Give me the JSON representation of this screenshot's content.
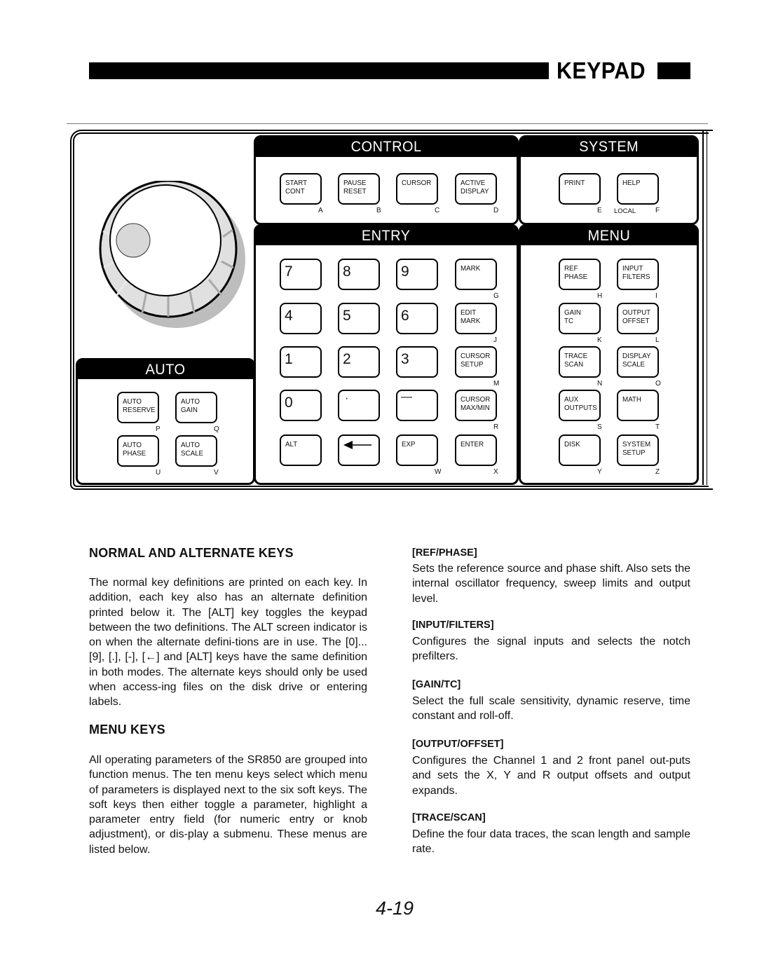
{
  "header": {
    "title": "KEYPAD"
  },
  "panel": {
    "sections": {
      "control": "CONTROL",
      "system": "SYSTEM",
      "entry": "ENTRY",
      "menu": "MENU",
      "auto": "AUTO"
    },
    "knob": {
      "icon": "knob-icon"
    },
    "control_keys": [
      {
        "label": "START\nCONT",
        "alt": "A"
      },
      {
        "label": "PAUSE\nRESET",
        "alt": "B"
      },
      {
        "label": "CURSOR",
        "alt": "C"
      },
      {
        "label": "ACTIVE\nDISPLAY",
        "alt": "D"
      }
    ],
    "system_keys": [
      {
        "label": "PRINT",
        "alt": "E"
      },
      {
        "label": "HELP",
        "alt": "F",
        "alt_extra": "LOCAL"
      }
    ],
    "entry_keys": [
      {
        "label": "7",
        "alt": "",
        "type": "num"
      },
      {
        "label": "8",
        "alt": "",
        "type": "num"
      },
      {
        "label": "9",
        "alt": "",
        "type": "num"
      },
      {
        "label": "MARK",
        "alt": "G"
      },
      {
        "label": "4",
        "alt": "",
        "type": "num"
      },
      {
        "label": "5",
        "alt": "",
        "type": "num"
      },
      {
        "label": "6",
        "alt": "",
        "type": "num"
      },
      {
        "label": "EDIT\nMARK",
        "alt": "J"
      },
      {
        "label": "1",
        "alt": "",
        "type": "num"
      },
      {
        "label": "2",
        "alt": "",
        "type": "num"
      },
      {
        "label": "3",
        "alt": "",
        "type": "num"
      },
      {
        "label": "CURSOR\nSETUP",
        "alt": "M"
      },
      {
        "label": "0",
        "alt": "",
        "type": "num"
      },
      {
        "label": "·",
        "alt": "",
        "type": "num"
      },
      {
        "label": "—",
        "alt": "",
        "type": "num"
      },
      {
        "label": "CURSOR\nMAX/MIN",
        "alt": "R"
      },
      {
        "label": "ALT",
        "alt": ""
      },
      {
        "label": "←",
        "alt": "",
        "type": "arrow",
        "icon": "backspace-arrow-icon"
      },
      {
        "label": "EXP",
        "alt": "W"
      },
      {
        "label": "ENTER",
        "alt": "X"
      }
    ],
    "menu_keys": [
      {
        "label": "REF\nPHASE",
        "alt": "H"
      },
      {
        "label": "INPUT\nFILTERS",
        "alt": "I"
      },
      {
        "label": "GAIN\nTC",
        "alt": "K"
      },
      {
        "label": "OUTPUT\nOFFSET",
        "alt": "L"
      },
      {
        "label": "TRACE\nSCAN",
        "alt": "N"
      },
      {
        "label": "DISPLAY\nSCALE",
        "alt": "O"
      },
      {
        "label": "AUX\nOUTPUTS",
        "alt": "S"
      },
      {
        "label": "MATH",
        "alt": "T"
      },
      {
        "label": "DISK",
        "alt": "Y"
      },
      {
        "label": "SYSTEM\nSETUP",
        "alt": "Z"
      }
    ],
    "auto_keys": [
      {
        "label": "AUTO\nRESERVE",
        "alt": "P"
      },
      {
        "label": "AUTO\nGAIN",
        "alt": "Q"
      },
      {
        "label": "AUTO\nPHASE",
        "alt": "U"
      },
      {
        "label": "AUTO\nSCALE",
        "alt": "V"
      }
    ]
  },
  "left_column": {
    "normal_heading": "NORMAL AND ALTERNATE KEYS",
    "normal_text": "The normal key definitions are printed on each key. In addition, each key also has an alternate definition printed below it. The [ALT] key toggles the keypad between the two definitions. The ALT screen indicator is on when the alternate defini-tions are in use. The [0]...[9], [.], [-], [←] and [ALT] keys have the same definition in both modes. The alternate keys should only be used when access-ing files on the disk drive or entering labels.",
    "menu_heading": "MENU KEYS",
    "menu_text": "All operating parameters of the SR850 are grouped into function menus. The ten menu keys select which menu of parameters is displayed next to the six soft keys. The soft keys then either toggle a parameter, highlight a parameter entry field (for numeric entry or knob adjustment), or dis-play a submenu. These menus are listed below."
  },
  "right_column": {
    "items": [
      {
        "heading": "[REF/PHASE]",
        "text": "Sets the reference source and phase shift. Also sets the internal oscillator frequency, sweep limits and output level."
      },
      {
        "heading": "[INPUT/FILTERS]",
        "text": "Configures the signal inputs and selects the notch prefilters."
      },
      {
        "heading": "[GAIN/TC]",
        "text": "Select the full scale sensitivity, dynamic reserve, time constant and roll-off."
      },
      {
        "heading": "[OUTPUT/OFFSET]",
        "text": "Configures the Channel 1 and 2 front panel out-puts and sets the X, Y and R output offsets and output expands."
      },
      {
        "heading": "[TRACE/SCAN]",
        "text": "Define the four data traces, the scan length and sample rate."
      }
    ]
  },
  "footer": {
    "page_number": "4-19"
  }
}
